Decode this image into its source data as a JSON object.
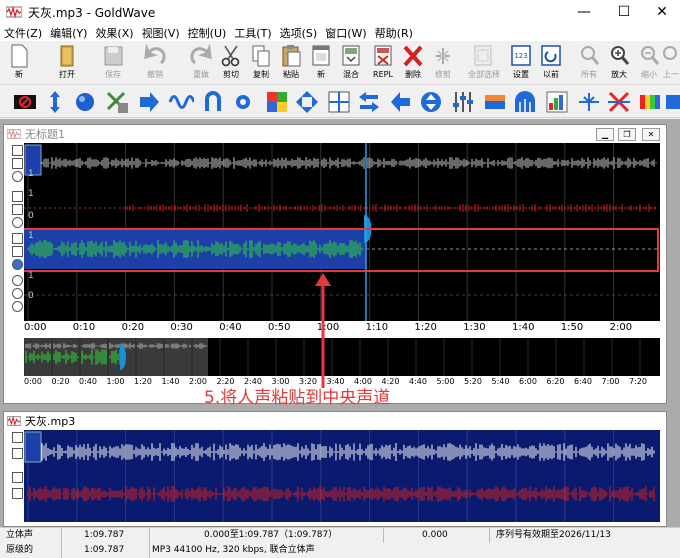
{
  "titlebar": {
    "title": "天灰.mp3 - GoldWave",
    "minimize": "—",
    "maximize": "☐",
    "close": "✕"
  },
  "menu": [
    "文件(Z)",
    "编辑(Y)",
    "效果(X)",
    "视图(V)",
    "控制(U)",
    "工具(T)",
    "选项(S)",
    "窗口(W)",
    "帮助(R)"
  ],
  "toolbar": {
    "new": "新",
    "open": "打开",
    "save": "保存",
    "undo": "撤销",
    "redo": "重做",
    "cut": "剪切",
    "copy": "复制",
    "paste": "粘贴",
    "new2": "新",
    "mix": "混合",
    "repl": "REPL",
    "delete": "删除",
    "trim": "修剪",
    "select_all": "全部选择",
    "settings": "设置",
    "previous": "以前",
    "all": "所有",
    "zoom_in": "放大",
    "zoom_out": "缩小",
    "prev_zoom": "上一"
  },
  "colors": {
    "waveform_white": "#cfcfcf",
    "waveform_red": "#d9201a",
    "waveform_green": "#33d63a",
    "selection_blue": "#1c3fa8",
    "highlight_box": "#e53a3a"
  },
  "doc1": {
    "title": "无标题1",
    "ticks": [
      "0:00",
      "0:10",
      "0:20",
      "0:30",
      "0:40",
      "0:50",
      "1:00",
      "1:10",
      "1:20",
      "1:30",
      "1:40",
      "1:50",
      "2:00"
    ],
    "tracks": [
      {
        "scale_top": "1",
        "scale_bottom": "0"
      },
      {
        "scale_top": "1",
        "scale_bottom": "0"
      },
      {
        "scale_top": "1",
        "scale_bottom": "0"
      },
      {
        "scale_top": "1",
        "scale_bottom": "0"
      }
    ],
    "overview_ticks": [
      "0:00",
      "0:20",
      "0:40",
      "1:00",
      "1:20",
      "1:40",
      "2:00",
      "2:20",
      "2:40",
      "3:00",
      "3:20",
      "3:40",
      "4:00",
      "4:20",
      "4:40",
      "5:00",
      "5:20",
      "5:40",
      "6:00",
      "6:20",
      "6:40",
      "7:00",
      "7:20"
    ]
  },
  "doc2": {
    "title": "天灰.mp3"
  },
  "annotation": "5.将人声粘贴到中央声道",
  "status": {
    "channel": "立体声",
    "length": "1:09.787",
    "selection": "0.000至1:09.787（1:09.787）",
    "position": "0.000",
    "serial": "序列号有效期至2026/11/13",
    "original": "原级的",
    "orig_length": "1:09.787",
    "format": "MP3 44100 Hz, 320 kbps, 联合立体声"
  }
}
